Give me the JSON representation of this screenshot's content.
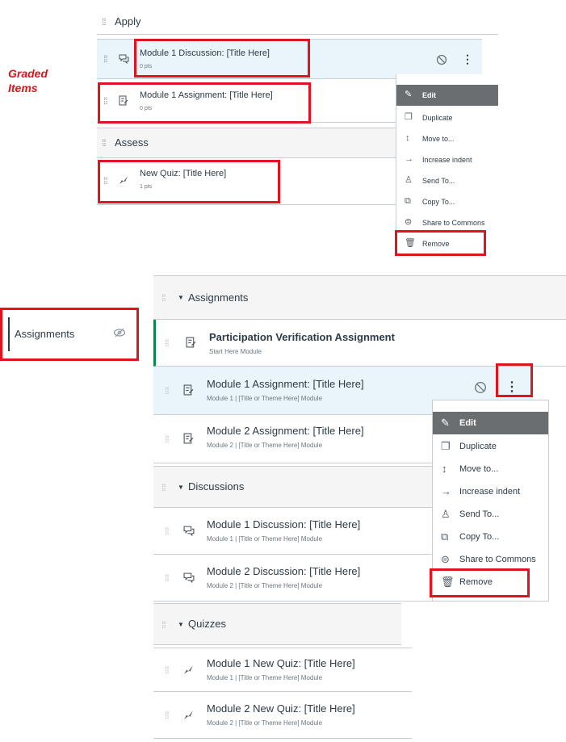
{
  "graded_label": "Graded Items",
  "top": {
    "apply_header": "Apply",
    "assess_header": "Assess",
    "items": [
      {
        "title": "Module 1 Discussion: [Title Here]",
        "pts": "0 pts",
        "icon": "discussion-icon"
      },
      {
        "title": "Module 1 Assignment: [Title Here]",
        "pts": "0 pts",
        "icon": "assignment-icon"
      },
      {
        "title": "New Quiz: [Title Here]",
        "pts": "1 pts",
        "icon": "quiz-icon"
      }
    ],
    "menu": [
      "Edit",
      "Duplicate",
      "Move to...",
      "Increase indent",
      "Send To...",
      "Copy To...",
      "Share to Commons",
      "Remove"
    ]
  },
  "sidebar": {
    "assignments_label": "Assignments"
  },
  "bottom": {
    "groups": [
      {
        "header": "Assignments",
        "items": [
          {
            "title": "Participation Verification Assignment",
            "sub": "Start Here Module"
          },
          {
            "title": "Module 1 Assignment: [Title Here]",
            "sub": "Module 1 | [Title or Theme Here] Module"
          },
          {
            "title": "Module 2 Assignment: [Title Here]",
            "sub": "Module 2 | [Title or Theme Here] Module"
          }
        ]
      },
      {
        "header": "Discussions",
        "items": [
          {
            "title": "Module 1 Discussion: [Title Here]",
            "sub": "Module 1 | [Title or Theme Here] Module"
          },
          {
            "title": "Module 2 Discussion: [Title Here]",
            "sub": "Module 2 | [Title or Theme Here] Module"
          }
        ]
      },
      {
        "header": "Quizzes",
        "items": [
          {
            "title": "Module 1 New Quiz: [Title Here]",
            "sub": "Module 1 | [Title or Theme Here] Module"
          },
          {
            "title": "Module 2 New Quiz: [Title Here]",
            "sub": "Module 2 | [Title or Theme Here] Module"
          }
        ]
      }
    ],
    "menu": [
      "Edit",
      "Duplicate",
      "Move to...",
      "Increase indent",
      "Send To...",
      "Copy To...",
      "Share to Commons",
      "Remove"
    ]
  },
  "colors": {
    "highlight_red": "#e0141e",
    "accent_green": "#0b874b"
  }
}
